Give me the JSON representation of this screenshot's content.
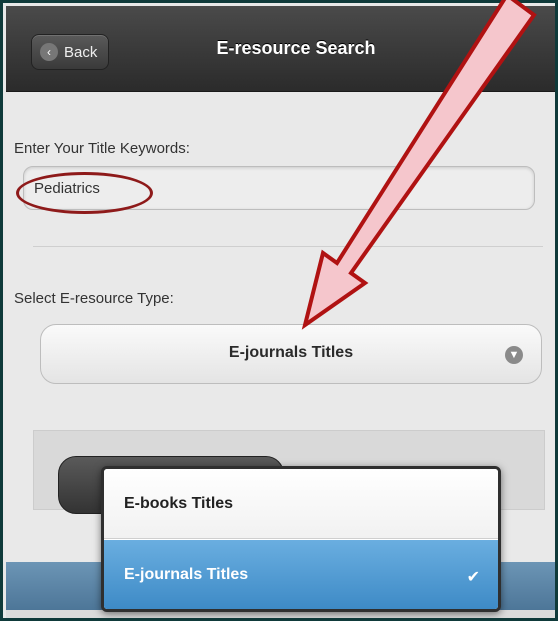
{
  "header": {
    "back_label": "Back",
    "back_icon": "chevron-left-icon",
    "title": "E-resource Search"
  },
  "form": {
    "keyword_label": "Enter Your Title Keywords:",
    "keyword_value": "Pediatrics",
    "type_label": "Select E-resource Type:",
    "type_selected": "E-journals Titles",
    "caret_icon": "chevron-down-icon"
  },
  "dropdown": {
    "options": [
      {
        "label": "E-books Titles",
        "selected": false
      },
      {
        "label": "E-journals Titles",
        "selected": true
      }
    ],
    "check_icon": "check-icon",
    "highlight_color": "#3d8ac6"
  },
  "annotations": {
    "color": "#b01212",
    "fill": "#f5c6cc"
  }
}
